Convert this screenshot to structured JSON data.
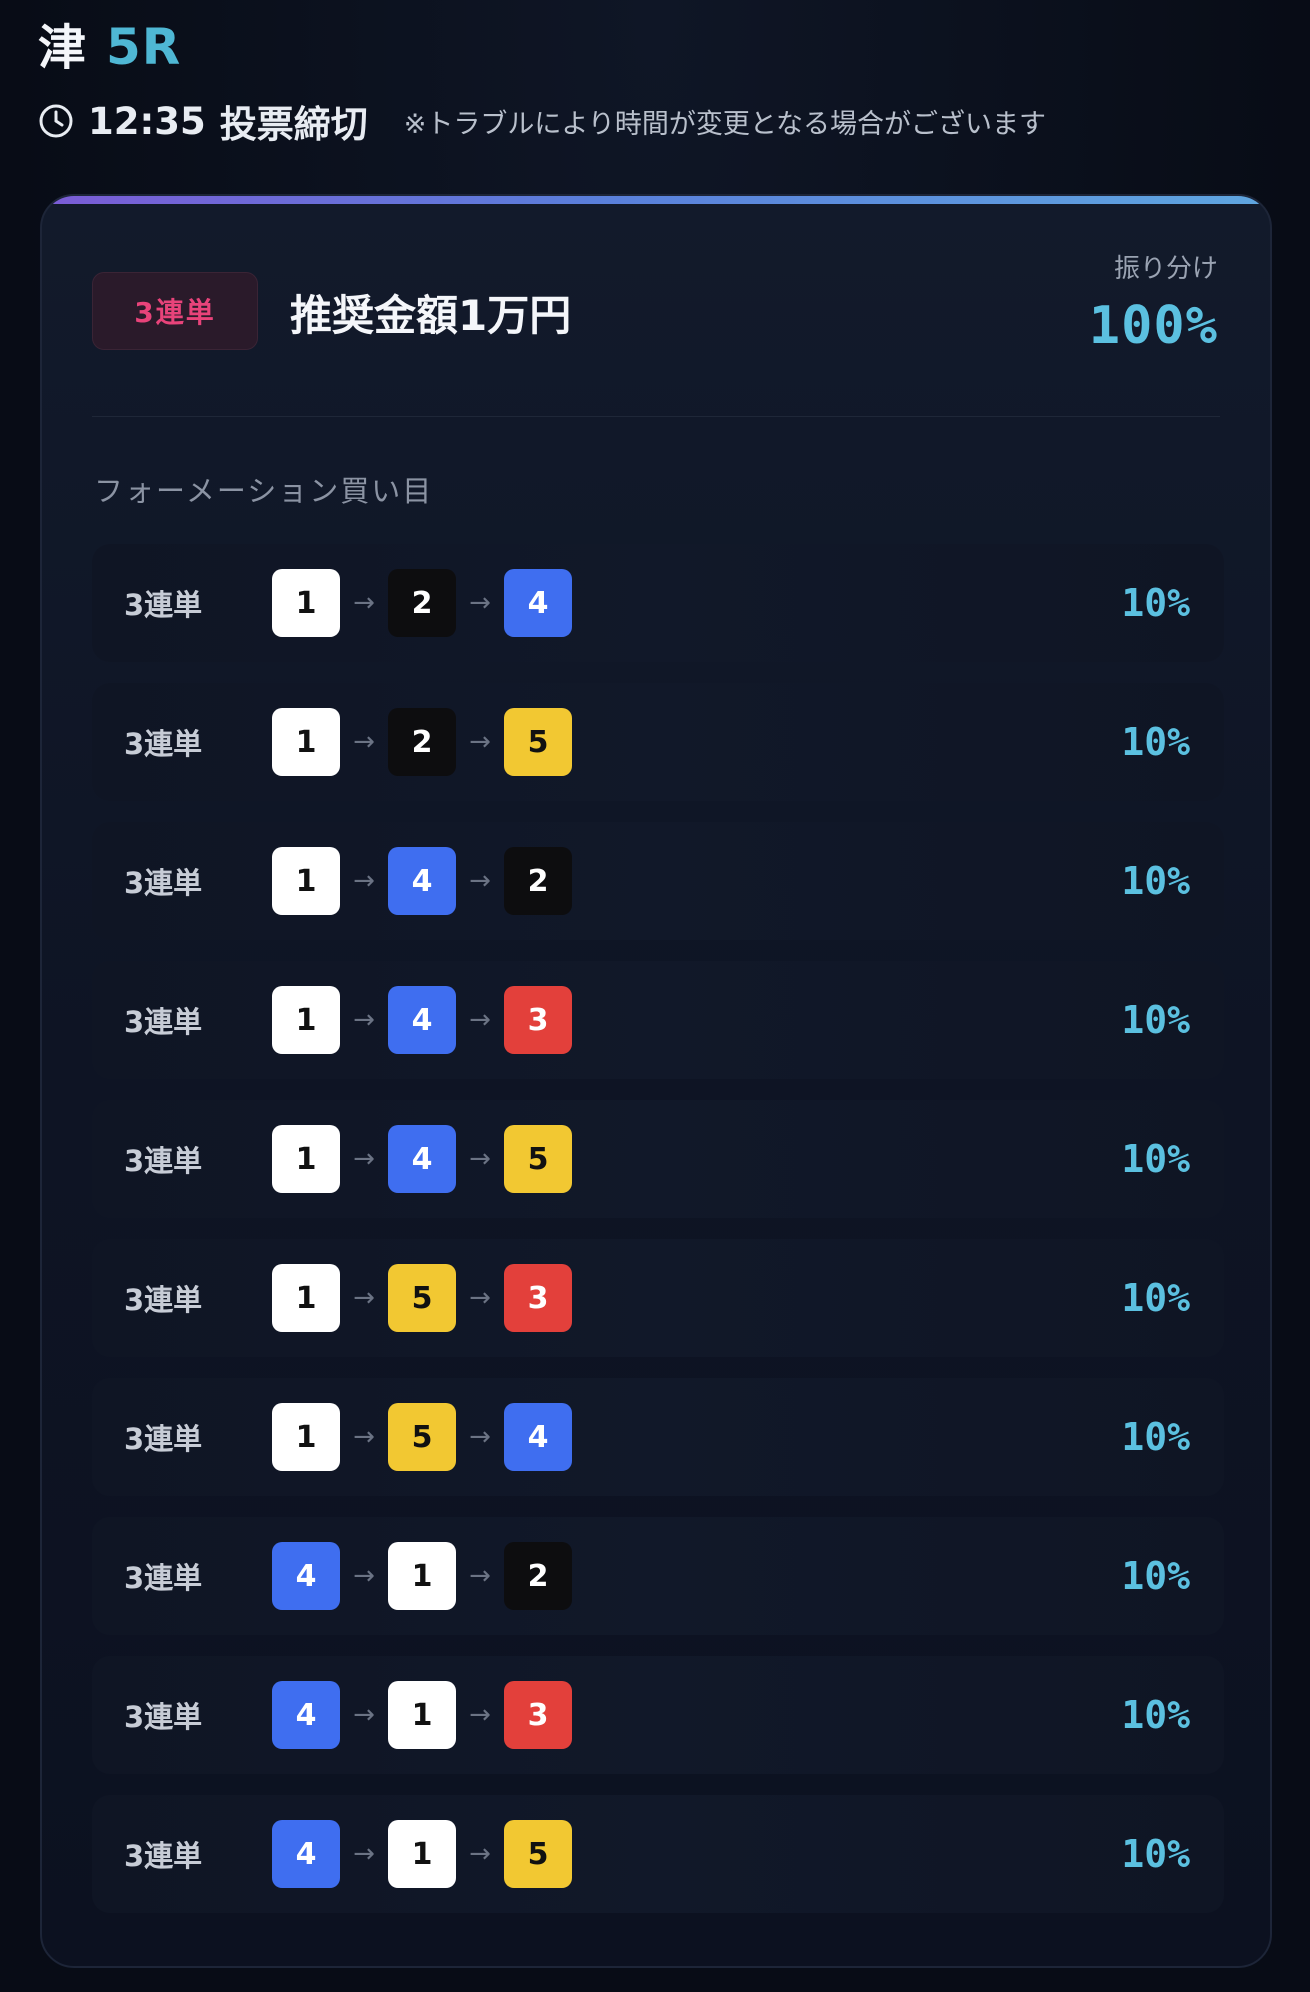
{
  "header": {
    "venue": "津",
    "race": "5R"
  },
  "deadline": {
    "icon": "clock-icon",
    "time": "12:35",
    "label": "投票締切",
    "note": "※トラブルにより時間が変更となる場合がございます"
  },
  "card": {
    "badge": "3連単",
    "amount": "推奨金額1万円",
    "allocation_label": "振り分け",
    "allocation_value": "100%",
    "section_label": "フォーメーション買い目"
  },
  "boat_colors": {
    "1": {
      "bg": "#ffffff",
      "fg": "#111111"
    },
    "2": {
      "bg": "#0d0d0f",
      "fg": "#ffffff"
    },
    "3": {
      "bg": "#e3403b",
      "fg": "#ffffff"
    },
    "4": {
      "bg": "#3f6ef0",
      "fg": "#ffffff"
    },
    "5": {
      "bg": "#f2c832",
      "fg": "#111111"
    }
  },
  "arrow_glyph": "→",
  "rows": [
    {
      "type": "3連単",
      "combo": [
        "1",
        "2",
        "4"
      ],
      "percent": "10%"
    },
    {
      "type": "3連単",
      "combo": [
        "1",
        "2",
        "5"
      ],
      "percent": "10%"
    },
    {
      "type": "3連単",
      "combo": [
        "1",
        "4",
        "2"
      ],
      "percent": "10%"
    },
    {
      "type": "3連単",
      "combo": [
        "1",
        "4",
        "3"
      ],
      "percent": "10%"
    },
    {
      "type": "3連単",
      "combo": [
        "1",
        "4",
        "5"
      ],
      "percent": "10%"
    },
    {
      "type": "3連単",
      "combo": [
        "1",
        "5",
        "3"
      ],
      "percent": "10%"
    },
    {
      "type": "3連単",
      "combo": [
        "1",
        "5",
        "4"
      ],
      "percent": "10%"
    },
    {
      "type": "3連単",
      "combo": [
        "4",
        "1",
        "2"
      ],
      "percent": "10%"
    },
    {
      "type": "3連単",
      "combo": [
        "4",
        "1",
        "3"
      ],
      "percent": "10%"
    },
    {
      "type": "3連単",
      "combo": [
        "4",
        "1",
        "5"
      ],
      "percent": "10%"
    }
  ]
}
